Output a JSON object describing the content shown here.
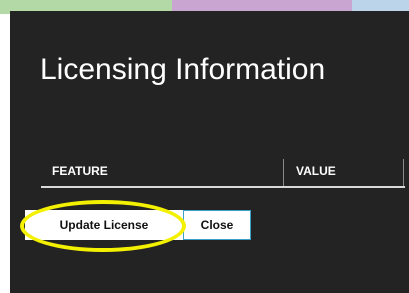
{
  "dialog": {
    "title": "Licensing Information",
    "table": {
      "columns": [
        "FEATURE",
        "VALUE"
      ],
      "rows": []
    },
    "buttons": {
      "update_label": "Update License",
      "close_label": "Close"
    }
  },
  "annotation": {
    "highlight_color": "#f3f000",
    "highlighted": "update-license-button"
  },
  "colors": {
    "dialog_background": "#232323",
    "title_text": "#ffffff",
    "close_border": "#3aa0c8"
  }
}
